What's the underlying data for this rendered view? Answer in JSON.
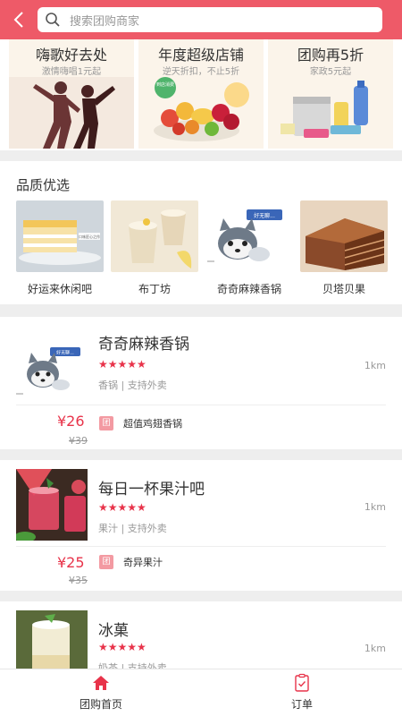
{
  "header": {
    "search_placeholder": "搜索团购商家"
  },
  "banners": [
    {
      "title": "嗨歌好去处",
      "subtitle": "激情嗨唱1元起"
    },
    {
      "title": "年度超级店铺",
      "subtitle": "逆天折扣，不止5折",
      "sticker": "到店消费"
    },
    {
      "title": "团购再5折",
      "subtitle": "家政5元起"
    }
  ],
  "quality": {
    "heading": "品质优选",
    "items": [
      {
        "name": "好运来休闲吧",
        "img_text": "口味匠心之作"
      },
      {
        "name": "布丁坊"
      },
      {
        "name": "奇奇麻辣香锅",
        "img_text": "好无聊..."
      },
      {
        "name": "贝塔贝果"
      }
    ]
  },
  "shops": [
    {
      "name": "奇奇麻辣香锅",
      "rating": "★★★★★",
      "tags": "香锅 | 支持外卖",
      "distance": "1km",
      "price": "¥26",
      "original_price": "¥39",
      "badge": "团",
      "deal": "超值鸡翅香锅",
      "img_text": "好无聊..."
    },
    {
      "name": "每日一杯果汁吧",
      "rating": "★★★★★",
      "tags": "果汁 | 支持外卖",
      "distance": "1km",
      "price": "¥25",
      "original_price": "¥35",
      "badge": "团",
      "deal": "奇异果汁"
    },
    {
      "name": "冰菓",
      "rating": "★★★★★",
      "tags": "奶茶 | 支持外卖",
      "distance": "1km"
    }
  ],
  "tabbar": [
    {
      "label": "团购首页",
      "icon": "home-icon",
      "active": true
    },
    {
      "label": "订单",
      "icon": "clipboard-icon",
      "active": false
    }
  ],
  "colors": {
    "brand": "#ee5a68",
    "price": "#e8334a",
    "badge": "#f39aa2"
  }
}
